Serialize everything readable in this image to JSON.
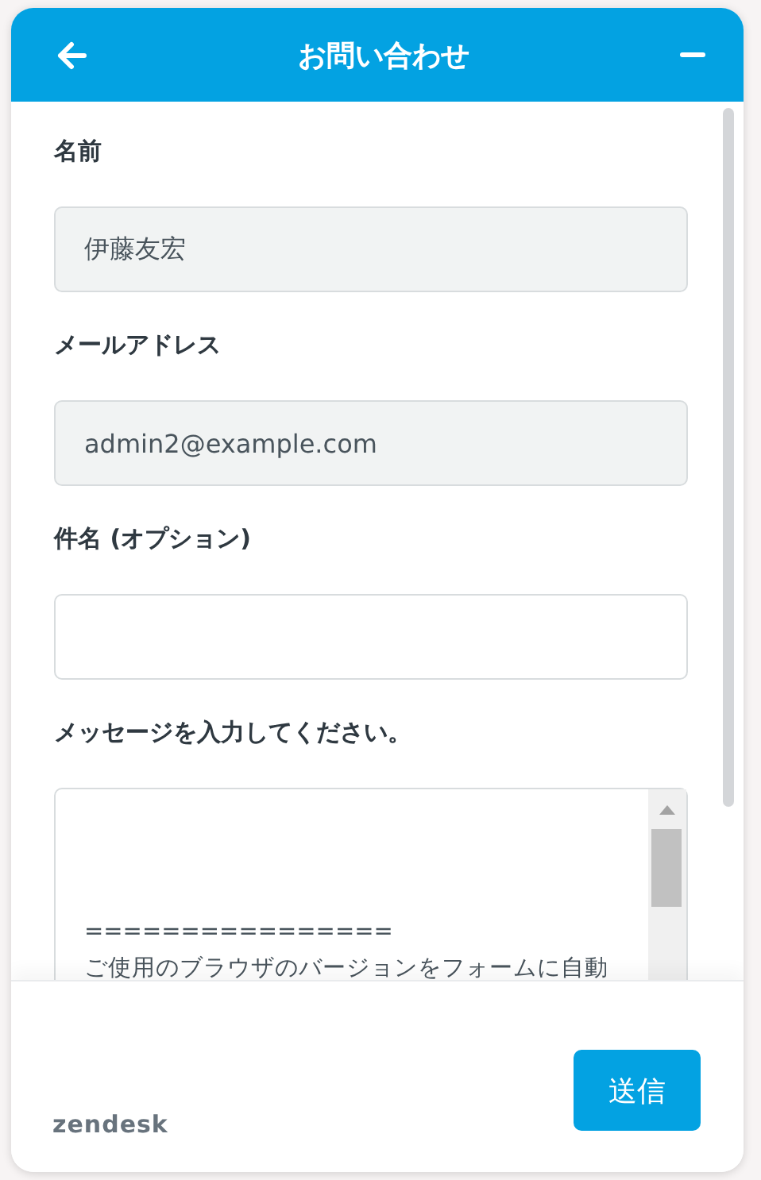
{
  "header": {
    "title": "お問い合わせ"
  },
  "fields": [
    {
      "kind": "input",
      "label": "名前",
      "value": "伊藤友宏",
      "readonly": true
    },
    {
      "kind": "input",
      "label": "メールアドレス",
      "value": "admin2@example.com",
      "readonly": true
    },
    {
      "kind": "input",
      "label": "件名 (オプション)",
      "readonly": false
    },
    {
      "kind": "textarea",
      "label": "メッセージを入力してください。",
      "lines": [
        "================",
        "ご使用のブラウザのバージョンをフォームに自動"
      ],
      "readonly": false
    }
  ],
  "footer": {
    "brand": "zendesk",
    "submit": "送信"
  }
}
